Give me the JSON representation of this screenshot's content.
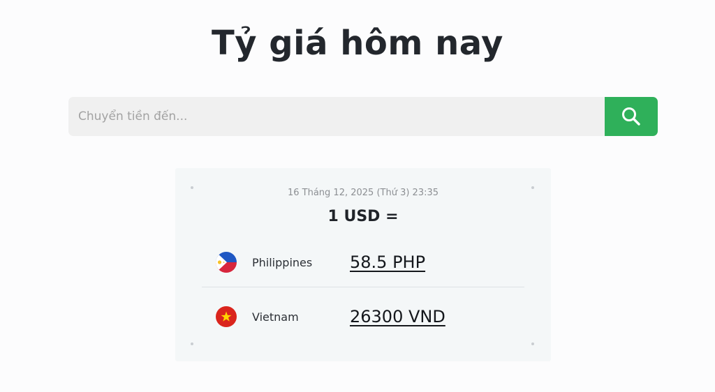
{
  "header": {
    "title": "Tỷ giá hôm nay"
  },
  "search": {
    "placeholder": "Chuyển tiền đến...",
    "button_icon": "search-icon",
    "button_color": "#2fb05a"
  },
  "rates_card": {
    "timestamp": "16 Tháng 12, 2025 (Thứ 3) 23:35",
    "base": "1 USD =",
    "rows": [
      {
        "country": "Philippines",
        "flag_icon": "philippines-flag-icon",
        "rate": "58.5 PHP"
      },
      {
        "country": "Vietnam",
        "flag_icon": "vietnam-flag-icon",
        "rate": "26300 VND"
      }
    ]
  }
}
